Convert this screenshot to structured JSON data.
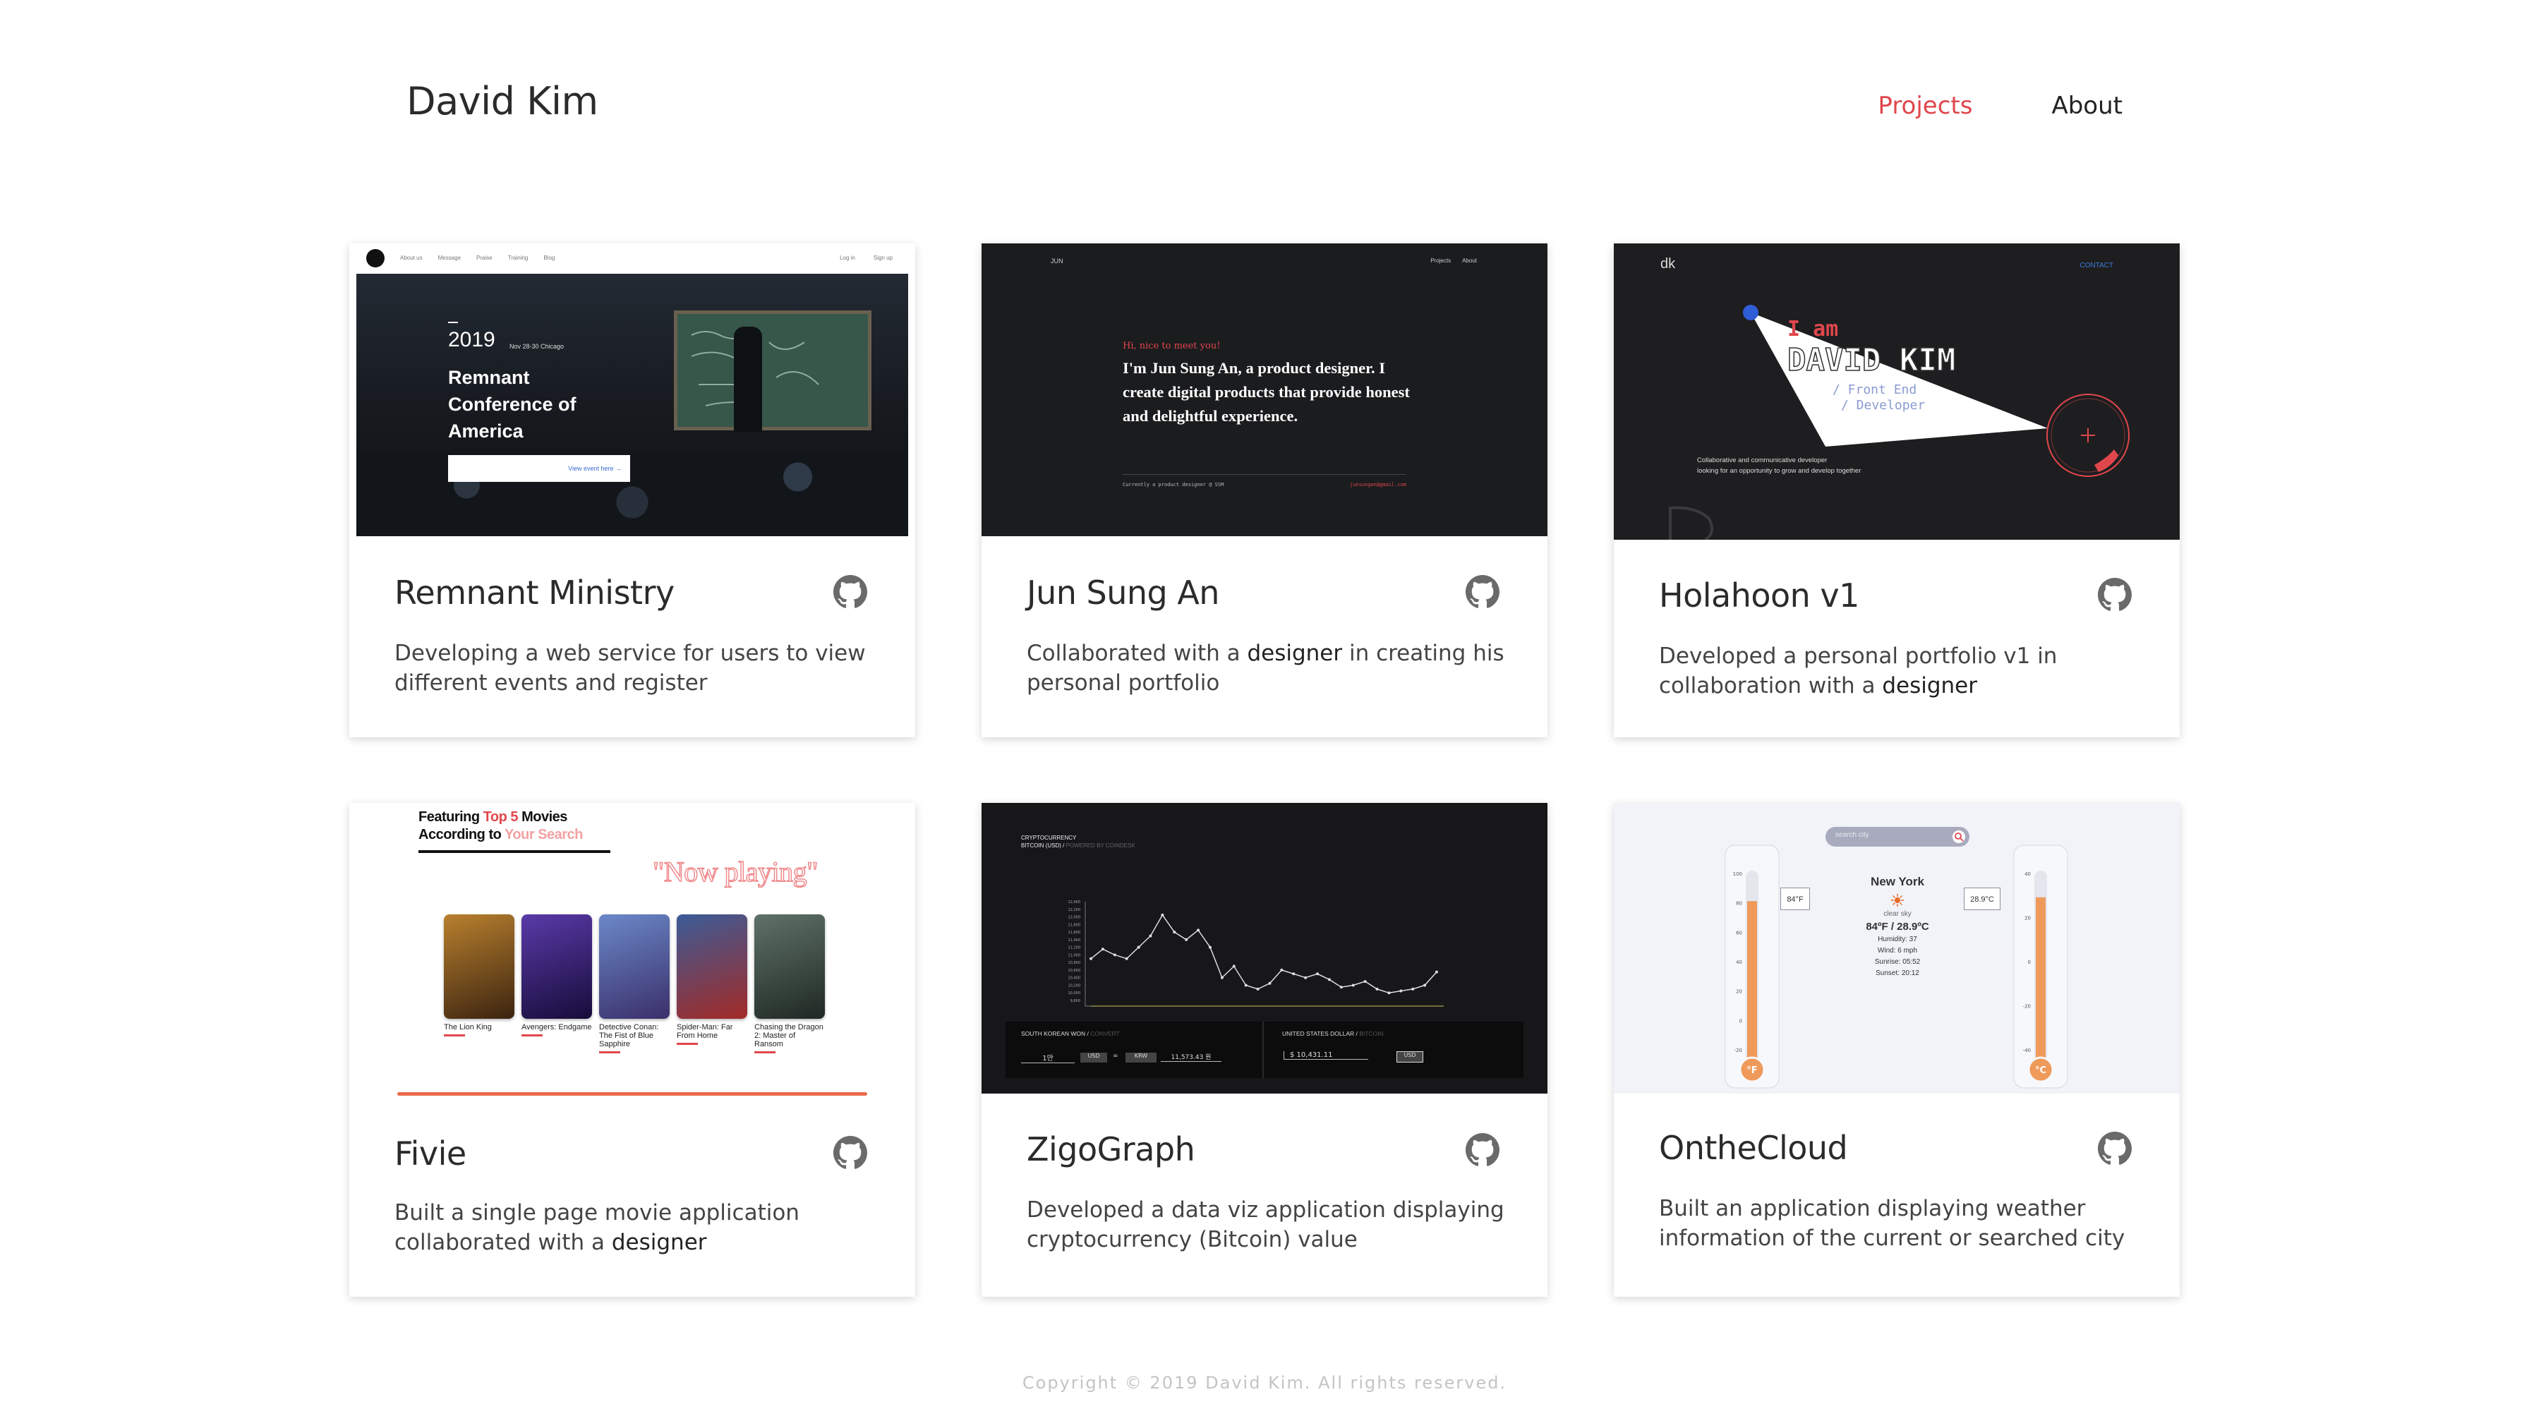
{
  "header": {
    "brand": "David Kim",
    "nav": [
      {
        "label": "Projects",
        "active": true
      },
      {
        "label": "About",
        "active": false
      }
    ]
  },
  "projects": [
    {
      "title": "Remnant Ministry",
      "description": [
        "Developing a web service for users to view different events and register"
      ],
      "thumb": {
        "nav": [
          "About us",
          "Message",
          "Praise",
          "Training",
          "Blog"
        ],
        "auth": [
          "Log in",
          "Sign up"
        ],
        "year": "2019",
        "date": "Nov 28-30 Chicago",
        "headline": [
          "Remnant",
          "Conference of",
          "America"
        ],
        "cta": "View event here →"
      }
    },
    {
      "title": "Jun Sung An",
      "description": [
        "Collaborated with a ",
        "designer",
        " in creating his personal portfolio"
      ],
      "thumb": {
        "logo": "JUN",
        "nav": [
          "Projects",
          "About"
        ],
        "greeting": "Hi, nice to meet you!",
        "intro": "I'm Jun Sung An, a product designer. I create digital products that provide honest and delightful experience.",
        "footer_left": "Currently a product designer @ SSM",
        "footer_right": "junsungan@gmail.com"
      }
    },
    {
      "title": "Holahoon v1",
      "description": [
        "Developed a personal portfolio v1 in collaboration with a ",
        "designer"
      ],
      "thumb": {
        "logo": "dk",
        "contact": "CONTACT",
        "iam": "I am",
        "name": "DAVID KIM",
        "roles": [
          "/ Front End",
          "/ Developer"
        ],
        "blurb": [
          "Collaborative and communicative developer",
          "looking for an opportunity to grow and develop together"
        ]
      }
    },
    {
      "title": "Fivie",
      "description": [
        "Built a single page movie application collaborated with a ",
        "designer"
      ],
      "thumb": {
        "heading_line1_pre": "Featuring ",
        "heading_highlight": "Top 5",
        "heading_line1_post": " Movies",
        "heading_line2_pre": "According to ",
        "heading_line2_highlight": "Your Search",
        "now_playing": "\"Now playing\"",
        "movies": [
          {
            "title": "The Lion King",
            "colors": [
              "#b8802e",
              "#3c2410"
            ]
          },
          {
            "title": "Avengers: Endgame",
            "colors": [
              "#5a3aa8",
              "#170c3a"
            ]
          },
          {
            "title": "Detective Conan: The Fist of Blue Sapphire",
            "colors": [
              "#6b88c8",
              "#3a2f6a"
            ]
          },
          {
            "title": "Spider-Man: Far From Home",
            "colors": [
              "#3b5c98",
              "#a32a26"
            ]
          },
          {
            "title": "Chasing the Dragon 2: Master of Ransom",
            "colors": [
              "#5f7268",
              "#1f2824"
            ]
          }
        ]
      }
    },
    {
      "title": "ZigoGraph",
      "description": [
        "Developed a data viz application displaying cryptocurrency (Bitcoin) value"
      ],
      "thumb": {
        "label_line1": "CRYPTOCURRENCY",
        "label_line2": "BITCOIN (USD) / ",
        "label_powered": "POWERED BY COINDESK",
        "left_panel": "SOUTH KOREAN WON / ",
        "left_panel_dim": "CONVERT",
        "right_panel": "UNITED STATES DOLLAR / ",
        "right_panel_dim": "BITCOIN",
        "left_amount": "1만",
        "left_unit": "USD",
        "left_krw": "KRW",
        "left_value": "11,573.43 원",
        "right_value": "$ 10,431.11",
        "right_unit": "USD",
        "y_ticks": [
          "12,400",
          "12,200",
          "12,000",
          "11,800",
          "11,600",
          "11,400",
          "11,200",
          "11,000",
          "10,800",
          "10,600",
          "10,400",
          "10,200",
          "10,000",
          "9,800"
        ],
        "series": [
          10900,
          11150,
          11000,
          10900,
          11200,
          11500,
          12050,
          11600,
          11400,
          11650,
          11200,
          10400,
          10700,
          10200,
          10100,
          10250,
          10600,
          10500,
          10400,
          10500,
          10350,
          10150,
          10200,
          10300,
          10100,
          10000,
          10050,
          10100,
          10200,
          10550
        ]
      }
    },
    {
      "title": "OntheCloud",
      "description": [
        "Built an application displaying weather information of the current or searched city"
      ],
      "thumb": {
        "search_placeholder": "search city",
        "city": "New York",
        "condition": "clear sky",
        "temps": "84ºF / 28.9ºC",
        "humidity": "Humidity: 37",
        "wind": "Wind: 6 mph",
        "sunrise": "Sunrise: 05:52",
        "sunset": "Sunset: 20:12",
        "left_reading": "84°F",
        "right_reading": "28.9°C",
        "left_unit": "°F",
        "right_unit": "°C",
        "left_ticks": [
          "100",
          "80",
          "60",
          "40",
          "20",
          "0",
          "-20"
        ],
        "right_ticks": [
          "40",
          "20",
          "0",
          "-20",
          "-40"
        ],
        "left_fill": 0.84,
        "right_fill": 0.86
      }
    }
  ],
  "footer": "Copyright © 2019 David Kim. All rights reserved.",
  "colors": {
    "accent": "#e0474c",
    "text": "#2b2b2b",
    "muted": "#c4c4c4"
  },
  "icons": {
    "repo_link": "github-icon"
  }
}
